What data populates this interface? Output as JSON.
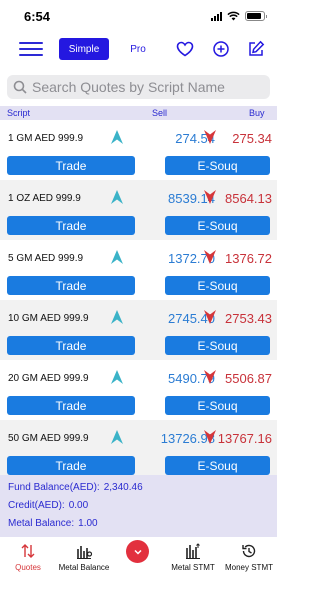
{
  "status_bar": {
    "time": "6:54",
    "battery_level": 0.85
  },
  "top_bar": {
    "simple_label": "Simple",
    "pro_label": "Pro"
  },
  "search": {
    "placeholder": "Search Quotes by Script Name"
  },
  "table_header": {
    "script": "Script",
    "sell": "Sell",
    "buy": "Buy"
  },
  "quotes": [
    {
      "name": "1 GM AED 999.9",
      "sell": "274.54",
      "buy": "275.34",
      "trade_label": "Trade",
      "esouq_label": "E-Souq"
    },
    {
      "name": "1 OZ AED 999.9",
      "sell": "8539.14",
      "buy": "8564.13",
      "trade_label": "Trade",
      "esouq_label": "E-Souq"
    },
    {
      "name": "5 GM AED 999.9",
      "sell": "1372.70",
      "buy": "1376.72",
      "trade_label": "Trade",
      "esouq_label": "E-Souq"
    },
    {
      "name": "10 GM AED 999.9",
      "sell": "2745.40",
      "buy": "2753.43",
      "trade_label": "Trade",
      "esouq_label": "E-Souq"
    },
    {
      "name": "20 GM AED 999.9",
      "sell": "5490.79",
      "buy": "5506.87",
      "trade_label": "Trade",
      "esouq_label": "E-Souq"
    },
    {
      "name": "50 GM AED 999.9",
      "sell": "13726.98",
      "buy": "13767.16",
      "trade_label": "Trade",
      "esouq_label": "E-Souq"
    }
  ],
  "balances": {
    "fund_label": "Fund Balance(AED):",
    "fund_value": "2,340.46",
    "credit_label": "Credit(AED):",
    "credit_value": "0.00",
    "metal_label": "Metal Balance:",
    "metal_value": "1.00"
  },
  "tabs": [
    {
      "label": "Quotes",
      "icon": "sort-arrows-icon",
      "active": true
    },
    {
      "label": "Metal Balance",
      "icon": "chart-icon",
      "active": false
    },
    {
      "label": "Metal STMT",
      "icon": "chart-bars-icon",
      "active": false
    },
    {
      "label": "Money STMT",
      "icon": "history-icon",
      "active": false
    }
  ],
  "colors": {
    "accent": "#2418e0",
    "button": "#1a7be0",
    "sell": "#2b7cd3",
    "buy": "#c8323a",
    "up_arrow": "#3bb3c8",
    "down_arrow": "#d6363a",
    "panel": "#e3e1f3"
  }
}
